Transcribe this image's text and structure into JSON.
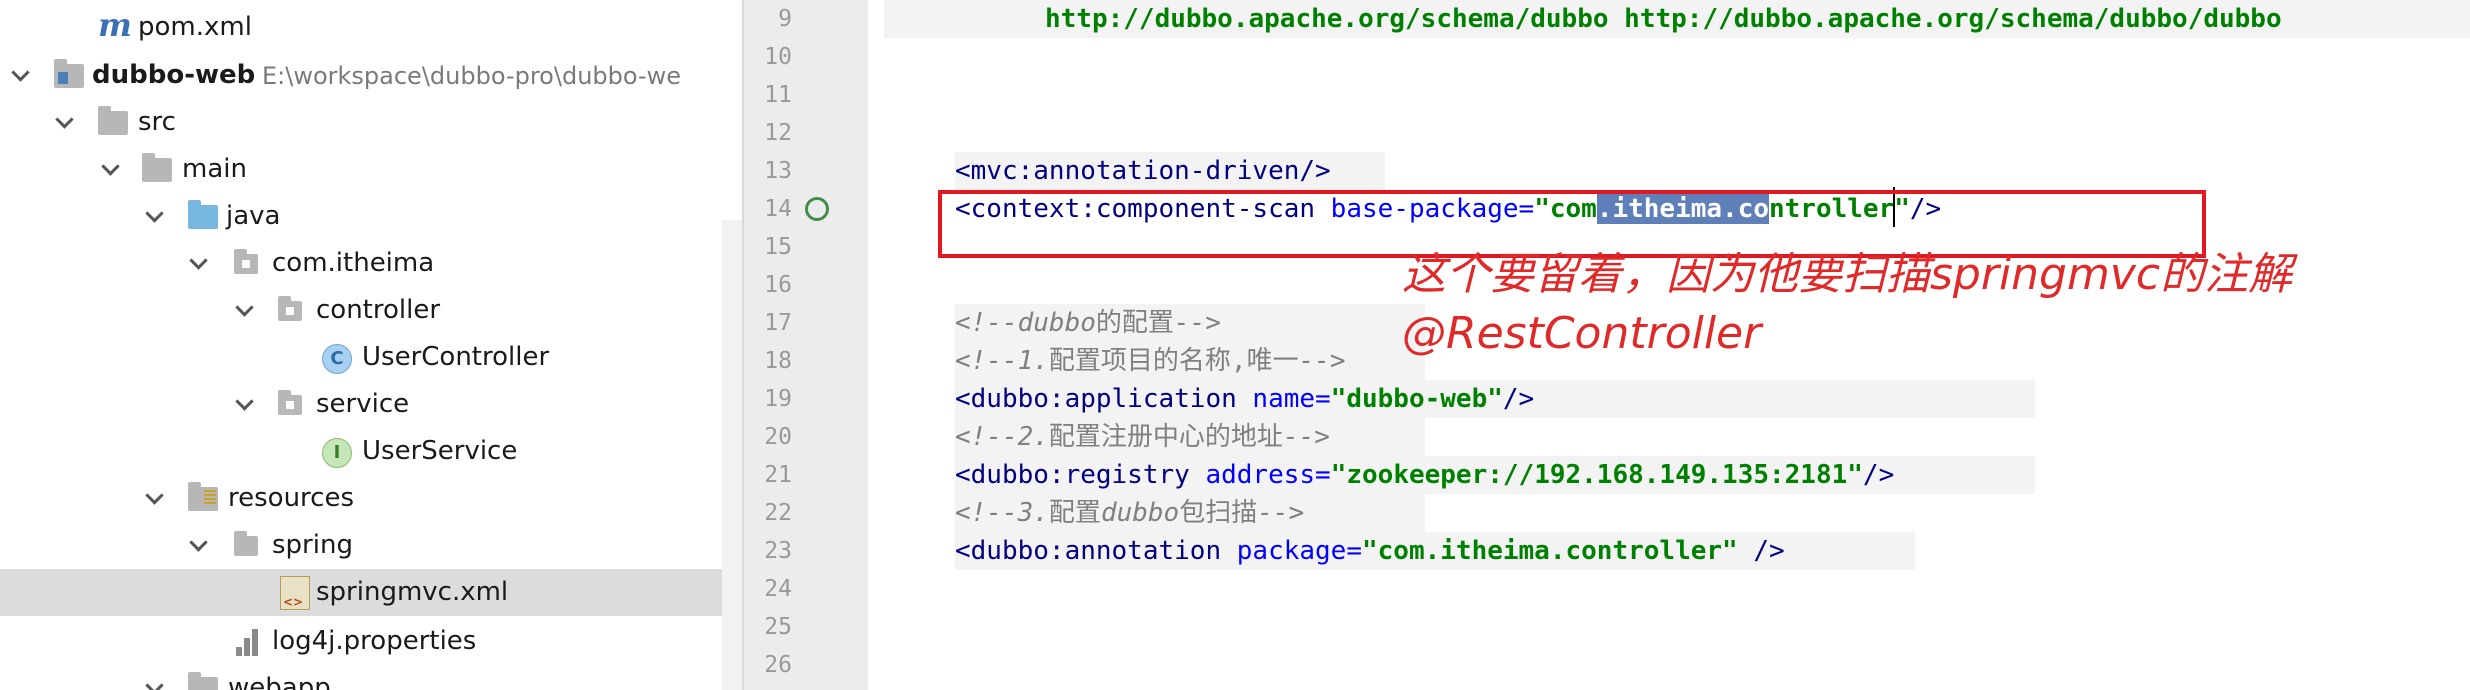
{
  "project_tree": {
    "items": [
      {
        "label": "pom.xml",
        "icon": "maven-icon"
      },
      {
        "label": "dubbo-web",
        "path": "E:\\workspace\\dubbo-pro\\dubbo-we",
        "icon": "module-folder-icon"
      },
      {
        "label": "src",
        "icon": "folder-icon"
      },
      {
        "label": "main",
        "icon": "folder-icon"
      },
      {
        "label": "java",
        "icon": "source-folder-icon"
      },
      {
        "label": "com.itheima",
        "icon": "package-icon"
      },
      {
        "label": "controller",
        "icon": "package-icon"
      },
      {
        "label": "UserController",
        "icon": "class-icon",
        "badge": "C"
      },
      {
        "label": "service",
        "icon": "package-icon"
      },
      {
        "label": "UserService",
        "icon": "interface-icon",
        "badge": "I"
      },
      {
        "label": "resources",
        "icon": "resources-folder-icon"
      },
      {
        "label": "spring",
        "icon": "folder-icon"
      },
      {
        "label": "springmvc.xml",
        "icon": "xml-file-icon",
        "selected": true
      },
      {
        "label": "log4j.properties",
        "icon": "properties-file-icon"
      },
      {
        "label": "webapp",
        "icon": "folder-icon"
      }
    ]
  },
  "editor": {
    "line_numbers": [
      "9",
      "10",
      "11",
      "12",
      "13",
      "14",
      "15",
      "16",
      "17",
      "18",
      "19",
      "20",
      "21",
      "22",
      "23",
      "24",
      "25",
      "26"
    ],
    "line9_text": "http://dubbo.apache.org/schema/dubbo http://dubbo.apache.org/schema/dubbo/dubbo",
    "line13": {
      "tag": "<mvc:annotation-driven/>"
    },
    "line14": {
      "open": "<context:component-scan",
      "attr": " base-package=",
      "q1": "\"com",
      "sel": ".itheima.co",
      "rest": "ntroller\"",
      "close": "/>"
    },
    "line17": {
      "pre": "<!--",
      "word": "dubbo",
      "cjk": "的配置",
      "post": "-->"
    },
    "line18": {
      "pre": "<!--1.",
      "cjk": "配置项目的名称,唯一",
      "post": "-->"
    },
    "line19": {
      "open": "<dubbo:application",
      "attr": " name=",
      "val": "\"dubbo-web\"",
      "close": "/>"
    },
    "line20": {
      "pre": "<!--2.",
      "cjk": "配置注册中心的地址",
      "post": "-->"
    },
    "line21": {
      "open": "<dubbo:registry",
      "attr": " address=",
      "val": "\"zookeeper://192.168.149.135:2181\"",
      "close": "/>"
    },
    "line22": {
      "pre": "<!--3.",
      "cjk": "配置",
      "word": "dubbo",
      "cjk2": "包扫描",
      "post": "-->"
    },
    "line23": {
      "open": "<dubbo:annotation",
      "attr": " package=",
      "val": "\"com.itheima.controller\"",
      "close": " />"
    }
  },
  "annotation": {
    "note_line1": "这个要留着，因为他要扫描springmvc的注解",
    "note_line2": "@RestController",
    "color": "#e01822"
  }
}
